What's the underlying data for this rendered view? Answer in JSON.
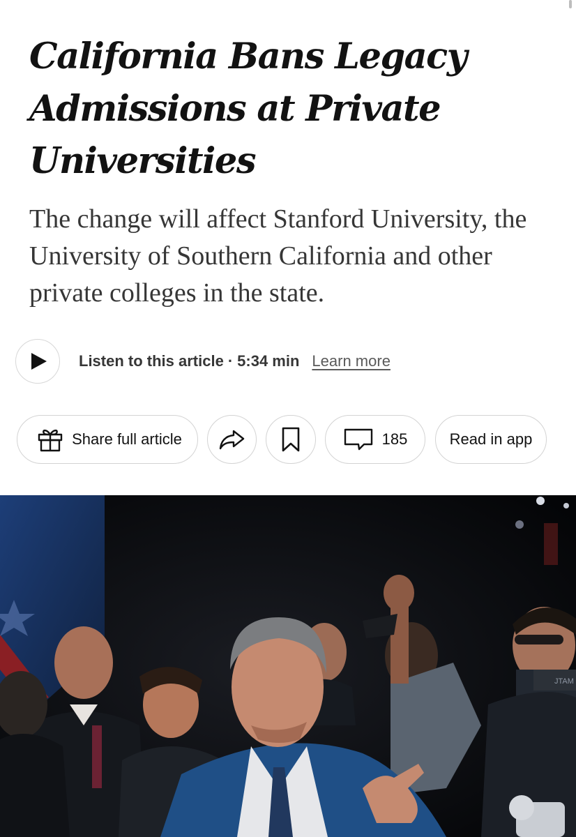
{
  "article": {
    "headline": "California Bans Legacy Admissions at Private Universities",
    "summary": "The change will affect Stanford University, the University of Southern California and other private colleges in the state."
  },
  "audio": {
    "listen_label": "Listen to this article",
    "separator": "·",
    "duration": "5:34 min",
    "learn_more": "Learn more",
    "play_icon": "play-icon"
  },
  "actions": {
    "share_label": "Share full article",
    "share_icon": "gift-icon",
    "forward_icon": "share-arrow-icon",
    "bookmark_icon": "bookmark-icon",
    "comments_icon": "comment-icon",
    "comments_count": "185",
    "read_in_app": "Read in app"
  },
  "photo": {
    "overlay_text": "JTAM"
  },
  "colors": {
    "text": "#121212",
    "summary_text": "#363636",
    "border": "#d3d3d3",
    "photo_background": "#060709",
    "suit_blue": "#1f4f86"
  }
}
